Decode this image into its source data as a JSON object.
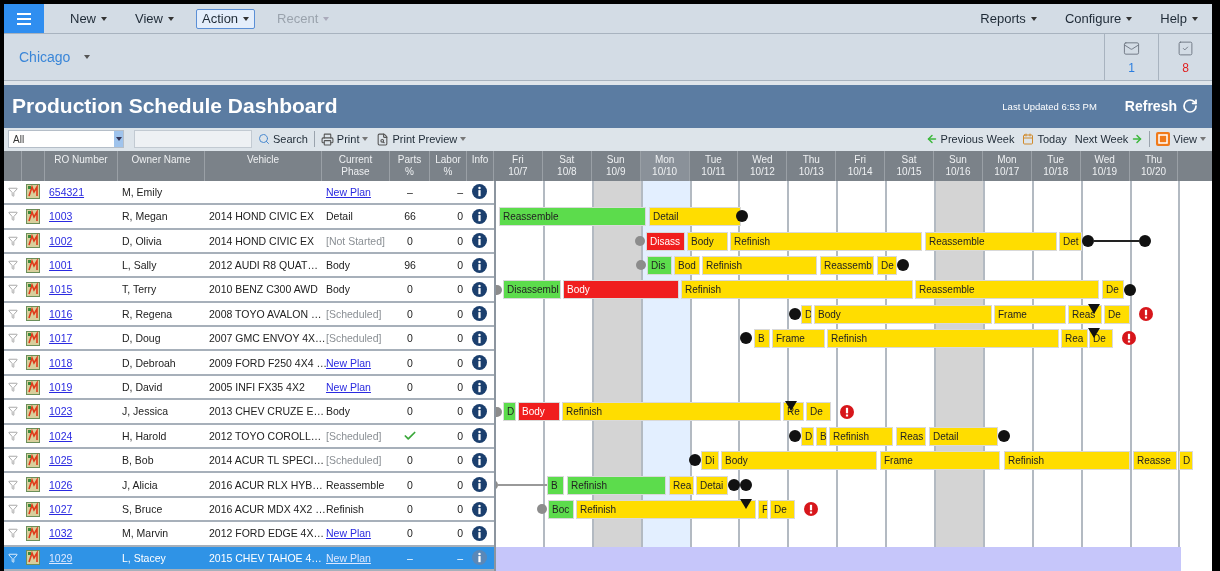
{
  "menu": {
    "left": [
      {
        "label": "New",
        "selected": false,
        "disabled": false
      },
      {
        "label": "View",
        "selected": false,
        "disabled": false
      },
      {
        "label": "Action",
        "selected": true,
        "disabled": false
      },
      {
        "label": "Recent",
        "selected": false,
        "disabled": true
      }
    ],
    "right": [
      "Reports",
      "Configure",
      "Help"
    ]
  },
  "location": "Chicago",
  "notifications": {
    "messages": "1",
    "tasks": "8"
  },
  "title": "Production Schedule Dashboard",
  "last_updated": "Last Updated 6:53 PM",
  "refresh": "Refresh",
  "toolbar": {
    "filter": "All",
    "search": "Search",
    "print": "Print",
    "print_preview": "Print Preview",
    "previous_week": "Previous Week",
    "today": "Today",
    "next_week": "Next Week",
    "view": "View"
  },
  "columns": [
    "RO Number",
    "Owner Name",
    "Vehicle",
    "Current\nPhase",
    "Parts\n%",
    "Labor\n%",
    "Info"
  ],
  "days": [
    {
      "day": "Fri",
      "date": "10/7",
      "kind": "weekday"
    },
    {
      "day": "Sat",
      "date": "10/8",
      "kind": "weekday"
    },
    {
      "day": "Sun",
      "date": "10/9",
      "kind": "sunday"
    },
    {
      "day": "Mon",
      "date": "10/10",
      "kind": "today"
    },
    {
      "day": "Tue",
      "date": "10/11",
      "kind": "weekday"
    },
    {
      "day": "Wed",
      "date": "10/12",
      "kind": "weekday"
    },
    {
      "day": "Thu",
      "date": "10/13",
      "kind": "weekday"
    },
    {
      "day": "Fri",
      "date": "10/14",
      "kind": "weekday"
    },
    {
      "day": "Sat",
      "date": "10/15",
      "kind": "weekday"
    },
    {
      "day": "Sun",
      "date": "10/16",
      "kind": "sunday"
    },
    {
      "day": "Mon",
      "date": "10/17",
      "kind": "weekday"
    },
    {
      "day": "Tue",
      "date": "10/18",
      "kind": "weekday"
    },
    {
      "day": "Wed",
      "date": "10/19",
      "kind": "weekday"
    },
    {
      "day": "Thu",
      "date": "10/20",
      "kind": "weekday"
    }
  ],
  "rows": [
    {
      "ro": "654321",
      "owner": "M, Emily",
      "phase": {
        "label": "New Plan",
        "kind": "link"
      },
      "parts": {
        "kind": "number",
        "text": "–"
      },
      "labor": "–",
      "selected": false,
      "alert": false,
      "bars": []
    },
    {
      "ro": "1003",
      "owner": "R, Megan",
      "vehicle": "2014 HOND CIVIC EX",
      "phase": {
        "label": "Detail",
        "kind": "text"
      },
      "parts": {
        "kind": "number",
        "text": "66"
      },
      "labor": "0",
      "selected": false,
      "alert": false,
      "bars": [
        {
          "label": "Reassemble",
          "color": "#5cdc4c"
        },
        {
          "label": "Detail",
          "color": "#ffdd00"
        }
      ]
    },
    {
      "ro": "1002",
      "owner": "D, Olivia",
      "vehicle": "2014 HOND CIVIC EX",
      "phase": {
        "label": "[Not Started]",
        "kind": "pending"
      },
      "parts": {
        "kind": "number",
        "text": "0"
      },
      "labor": "0",
      "selected": false,
      "alert": false,
      "bars": [
        {
          "label": "Disass",
          "color": "#f01e1e"
        },
        {
          "label": "Body",
          "color": "#ffdd00"
        },
        {
          "label": "Refinish",
          "color": "#ffdd00"
        },
        {
          "label": "Reassemble",
          "color": "#ffdd00"
        },
        {
          "label": "Det",
          "color": "#ffdd00"
        }
      ]
    },
    {
      "ro": "1001",
      "owner": "L, Sally",
      "vehicle": "2012 AUDI R8 QUAT…",
      "phase": {
        "label": "Body",
        "kind": "text"
      },
      "parts": {
        "kind": "number",
        "text": "96"
      },
      "labor": "0",
      "selected": false,
      "alert": false,
      "bars": [
        {
          "label": "Dis",
          "color": "#5cdc4c"
        },
        {
          "label": "Bod",
          "color": "#ffdd00"
        },
        {
          "label": "Refinish",
          "color": "#ffdd00"
        },
        {
          "label": "Reassemb",
          "color": "#ffdd00"
        },
        {
          "label": "De",
          "color": "#ffdd00"
        }
      ]
    },
    {
      "ro": "1015",
      "owner": "T, Terry",
      "vehicle": "2010 BENZ C300 AWD",
      "phase": {
        "label": "Body",
        "kind": "text"
      },
      "parts": {
        "kind": "number",
        "text": "0"
      },
      "labor": "0",
      "selected": false,
      "alert": false,
      "bars": [
        {
          "label": "Disassembl",
          "color": "#5cdc4c"
        },
        {
          "label": "Body",
          "color": "#f01e1e"
        },
        {
          "label": "Refinish",
          "color": "#ffdd00"
        },
        {
          "label": "Reassemble",
          "color": "#ffdd00"
        },
        {
          "label": "De",
          "color": "#ffdd00"
        }
      ]
    },
    {
      "ro": "1016",
      "owner": "R, Regena",
      "vehicle": "2008 TOYO AVALON …",
      "phase": {
        "label": "[Scheduled]",
        "kind": "pending"
      },
      "parts": {
        "kind": "number",
        "text": "0"
      },
      "labor": "0",
      "selected": false,
      "alert": true,
      "bars": [
        {
          "label": "D",
          "color": "#ffdd00"
        },
        {
          "label": "Body",
          "color": "#ffdd00"
        },
        {
          "label": "Frame",
          "color": "#ffdd00"
        },
        {
          "label": "Reas",
          "color": "#ffdd00"
        },
        {
          "label": "De",
          "color": "#ffdd00"
        }
      ]
    },
    {
      "ro": "1017",
      "owner": "D, Doug",
      "vehicle": "2007 GMC ENVOY 4X…",
      "phase": {
        "label": "[Scheduled]",
        "kind": "pending"
      },
      "parts": {
        "kind": "number",
        "text": "0"
      },
      "labor": "0",
      "selected": false,
      "alert": true,
      "bars": [
        {
          "label": "B",
          "color": "#ffdd00"
        },
        {
          "label": "Frame",
          "color": "#ffdd00"
        },
        {
          "label": "Refinish",
          "color": "#ffdd00"
        },
        {
          "label": "Rea",
          "color": "#ffdd00"
        },
        {
          "label": "De",
          "color": "#ffdd00"
        }
      ]
    },
    {
      "ro": "1018",
      "owner": "D, Debroah",
      "vehicle": "2009 FORD F250 4X4 …",
      "phase": {
        "label": "New Plan",
        "kind": "link"
      },
      "parts": {
        "kind": "number",
        "text": "0"
      },
      "labor": "0",
      "selected": false,
      "alert": false,
      "bars": []
    },
    {
      "ro": "1019",
      "owner": "D, David",
      "vehicle": "2005 INFI FX35 4X2",
      "phase": {
        "label": "New Plan",
        "kind": "link"
      },
      "parts": {
        "kind": "number",
        "text": "0"
      },
      "labor": "0",
      "selected": false,
      "alert": false,
      "bars": []
    },
    {
      "ro": "1023",
      "owner": "J, Jessica",
      "vehicle": "2013 CHEV CRUZE E…",
      "phase": {
        "label": "Body",
        "kind": "text"
      },
      "parts": {
        "kind": "number",
        "text": "0"
      },
      "labor": "0",
      "selected": false,
      "alert": true,
      "bars": [
        {
          "label": "D",
          "color": "#5cdc4c"
        },
        {
          "label": "Body",
          "color": "#f01e1e"
        },
        {
          "label": "Refinish",
          "color": "#ffdd00"
        },
        {
          "label": "Re",
          "color": "#ffdd00"
        },
        {
          "label": "De",
          "color": "#ffdd00"
        }
      ]
    },
    {
      "ro": "1024",
      "owner": "H, Harold",
      "vehicle": "2012 TOYO COROLL…",
      "phase": {
        "label": "[Scheduled]",
        "kind": "pending"
      },
      "parts": {
        "kind": "check"
      },
      "labor": "0",
      "selected": false,
      "alert": false,
      "bars": [
        {
          "label": "D",
          "color": "#ffdd00"
        },
        {
          "label": "B",
          "color": "#ffdd00"
        },
        {
          "label": "Refinish",
          "color": "#ffdd00"
        },
        {
          "label": "Reas",
          "color": "#ffdd00"
        },
        {
          "label": "Detail",
          "color": "#ffdd00"
        }
      ]
    },
    {
      "ro": "1025",
      "owner": "B, Bob",
      "vehicle": "2014 ACUR TL SPECI…",
      "phase": {
        "label": "[Scheduled]",
        "kind": "pending"
      },
      "parts": {
        "kind": "number",
        "text": "0"
      },
      "labor": "0",
      "selected": false,
      "alert": false,
      "bars": [
        {
          "label": "Di",
          "color": "#ffdd00"
        },
        {
          "label": "Body",
          "color": "#ffdd00"
        },
        {
          "label": "Frame",
          "color": "#ffdd00"
        },
        {
          "label": "Refinish",
          "color": "#ffdd00"
        },
        {
          "label": "Reasse",
          "color": "#ffdd00"
        },
        {
          "label": "D",
          "color": "#ffdd00"
        }
      ]
    },
    {
      "ro": "1026",
      "owner": "J, Alicia",
      "vehicle": "2016 ACUR RLX HYB…",
      "phase": {
        "label": "Reassemble",
        "kind": "text"
      },
      "parts": {
        "kind": "number",
        "text": "0"
      },
      "labor": "0",
      "selected": false,
      "alert": false,
      "bars": [
        {
          "label": "B",
          "color": "#5cdc4c"
        },
        {
          "label": "Refinish",
          "color": "#5cdc4c"
        },
        {
          "label": "Rea",
          "color": "#ffdd00"
        },
        {
          "label": "Detai",
          "color": "#ffdd00"
        }
      ]
    },
    {
      "ro": "1027",
      "owner": "S, Bruce",
      "vehicle": "2016 ACUR MDX 4X2 …",
      "phase": {
        "label": "Refinish",
        "kind": "text"
      },
      "parts": {
        "kind": "number",
        "text": "0"
      },
      "labor": "0",
      "selected": false,
      "alert": true,
      "bars": [
        {
          "label": "Boc",
          "color": "#5cdc4c"
        },
        {
          "label": "Refinish",
          "color": "#ffdd00"
        },
        {
          "label": "F",
          "color": "#ffdd00"
        },
        {
          "label": "De",
          "color": "#ffdd00"
        }
      ]
    },
    {
      "ro": "1032",
      "owner": "M, Marvin",
      "vehicle": "2012 FORD EDGE 4X…",
      "phase": {
        "label": "New Plan",
        "kind": "link"
      },
      "parts": {
        "kind": "number",
        "text": "0"
      },
      "labor": "0",
      "selected": false,
      "alert": false,
      "bars": []
    },
    {
      "ro": "1029",
      "owner": "L, Stacey",
      "vehicle": "2015 CHEV TAHOE 4…",
      "phase": {
        "label": "New Plan",
        "kind": "link"
      },
      "parts": {
        "kind": "number",
        "text": "–"
      },
      "labor": "–",
      "selected": true,
      "alert": false,
      "bars": []
    }
  ]
}
